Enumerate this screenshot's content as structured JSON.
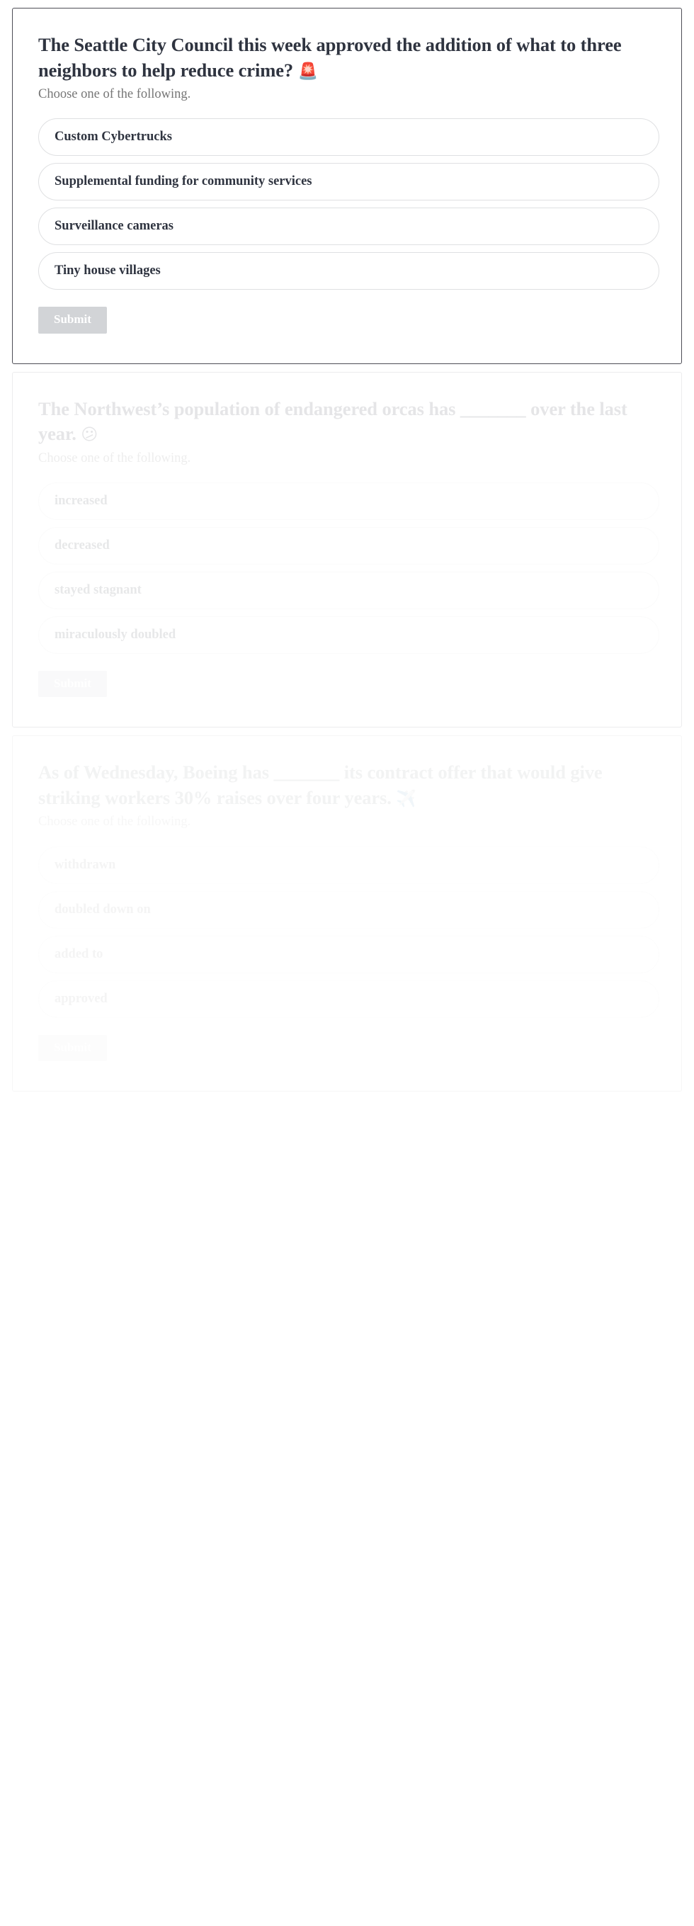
{
  "page": {
    "background_color": "#ffffff",
    "card_border_color": "#4d4d55",
    "option_border_color": "#dfe0e2",
    "text_color": "#2f3440",
    "muted_text_color": "#767676",
    "submit_bg_color": "#d2d4d7",
    "submit_text_color": "#ffffff"
  },
  "cards": [
    {
      "question_text": "The Seattle City Council this week approved the addition of what to three neighbors to help reduce crime?",
      "question_emoji": "🚨",
      "emoji_name": "police-car-light-icon",
      "subtitle": "Choose one of the following.",
      "options": [
        "Custom Cybertrucks",
        "Supplemental funding for community services",
        "Surveillance cameras",
        "Tiny house villages"
      ],
      "submit_label": "Submit"
    },
    {
      "question_prefix": "The Northwest’s population of endangered orcas has",
      "question_blank": "_______",
      "question_suffix": "over the last year.",
      "question_emoji": "😕",
      "emoji_name": "confused-face-icon",
      "subtitle": "Choose one of the following.",
      "options": [
        "increased",
        "decreased",
        "stayed stagnant",
        "miraculously doubled"
      ],
      "submit_label": "Submit"
    },
    {
      "question_prefix": "As of Wednesday, Boeing has",
      "question_blank": "_______",
      "question_suffix": "its contract offer that would give striking workers 30% raises over four years.",
      "question_emoji": "✈️",
      "emoji_name": "airplane-icon",
      "subtitle": "Choose one of the following.",
      "options": [
        "withdrawn",
        "doubled down on",
        "added to",
        "approved"
      ],
      "submit_label": "Submit"
    }
  ]
}
